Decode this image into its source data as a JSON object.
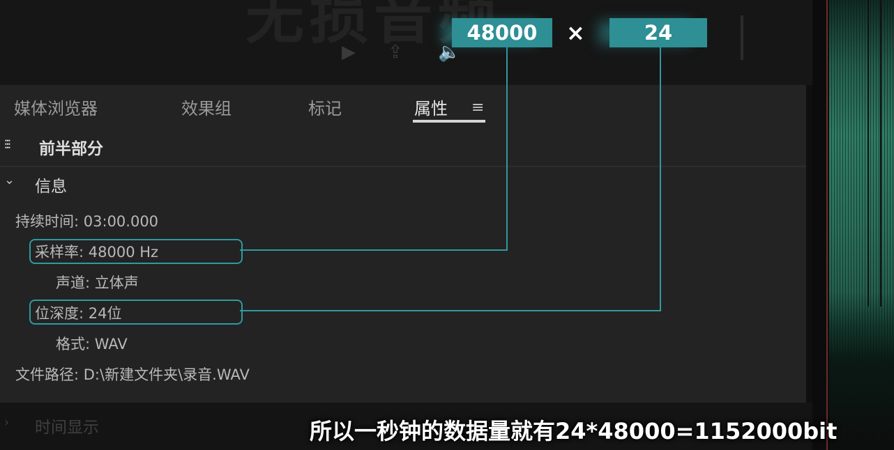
{
  "preview": {
    "title": "无损音频",
    "controls": {
      "play": "▶",
      "export": "⇪",
      "speaker": "🔈"
    }
  },
  "tabs": [
    {
      "label": "媒体浏览器",
      "active": false
    },
    {
      "label": "效果组",
      "active": false
    },
    {
      "label": "标记",
      "active": false
    },
    {
      "label": "属性",
      "active": true
    }
  ],
  "panel": {
    "menu_icon": "≡",
    "clip_icon": "audio-wave-icon",
    "clip_name": "前半部分",
    "info_section": {
      "label": "信息",
      "expanded": true
    },
    "properties": [
      {
        "label": "持续时间:",
        "value": "03:00.000"
      },
      {
        "label": "采样率:",
        "value": "48000 Hz"
      },
      {
        "label": "声道:",
        "value": "立体声"
      },
      {
        "label": "位深度:",
        "value": "24位"
      },
      {
        "label": "格式:",
        "value": "WAV"
      },
      {
        "label": "文件路径:",
        "value": "D:\\新建文件夹\\录音.WAV"
      }
    ],
    "time_display_section": {
      "label": "时间显示",
      "expanded": false
    }
  },
  "annotation": {
    "sample_rate": "48000",
    "times": "×",
    "bit_depth": "24"
  },
  "subtitle": "所以一秒钟的数据量就有24*48000=1152000bit",
  "colors": {
    "accent": "#2e8f95",
    "panel": "#232323",
    "background": "#0f0f10"
  }
}
